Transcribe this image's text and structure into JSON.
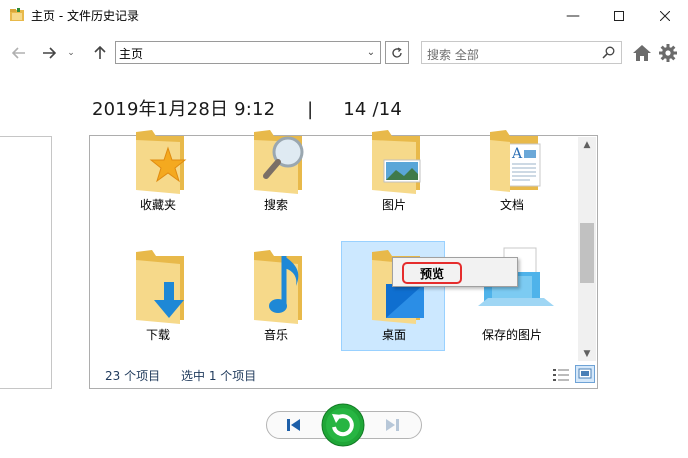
{
  "window": {
    "title": "主页 - 文件历史记录",
    "minimize_icon": "minimize-icon",
    "maximize_icon": "maximize-icon",
    "close_icon": "close-icon"
  },
  "nav": {
    "address": "主页",
    "search_placeholder": "搜索 全部"
  },
  "snapshot": {
    "date": "2019年1月28日 9:12",
    "separator": "|",
    "position": "14 /14"
  },
  "items": [
    {
      "label": "收藏夹",
      "icon": "favorites-folder-icon"
    },
    {
      "label": "搜索",
      "icon": "search-folder-icon"
    },
    {
      "label": "图片",
      "icon": "pictures-folder-icon"
    },
    {
      "label": "文档",
      "icon": "documents-folder-icon"
    },
    {
      "label": "下载",
      "icon": "downloads-folder-icon"
    },
    {
      "label": "音乐",
      "icon": "music-folder-icon"
    },
    {
      "label": "桌面",
      "icon": "desktop-folder-icon",
      "selected": true
    },
    {
      "label": "保存的图片",
      "icon": "saved-pictures-folder-icon"
    }
  ],
  "status": {
    "count": "23 个项目",
    "selected": "选中 1 个项目"
  },
  "context_menu": {
    "item": "预览"
  },
  "colors": {
    "selection_bg": "#cce8ff",
    "selection_border": "#99d1ff",
    "folder": "#f3cf6c",
    "restore_green": "#1fa637",
    "highlight_red": "#e52d2d"
  }
}
